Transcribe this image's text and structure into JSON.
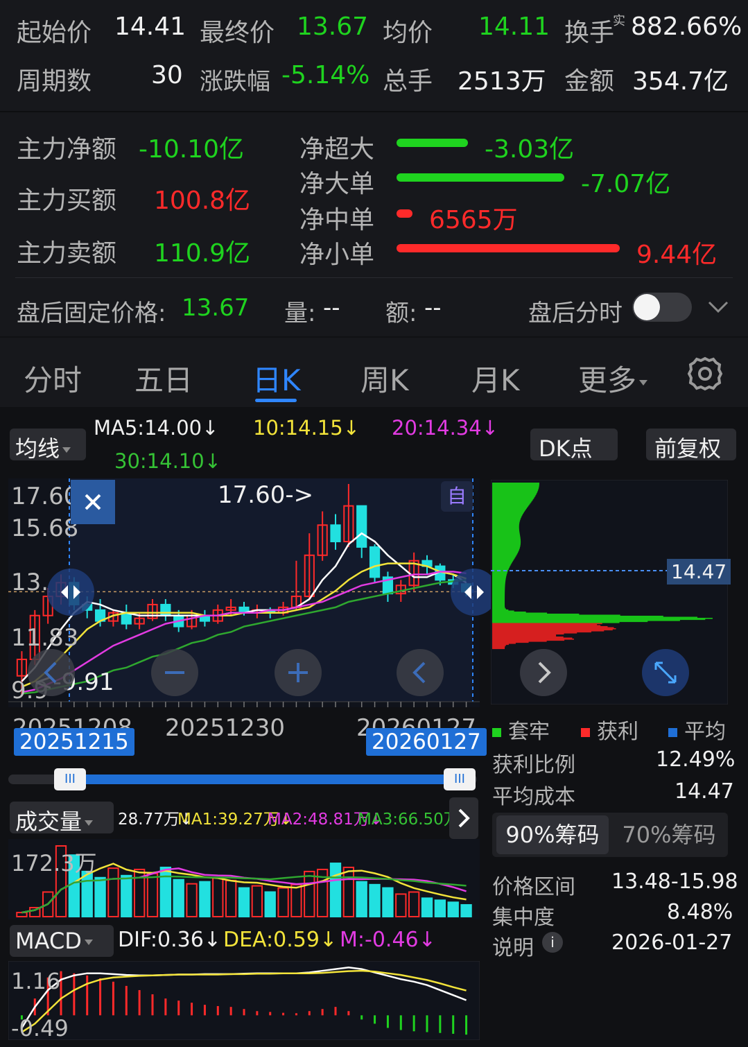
{
  "quote": {
    "open_label": "起始价",
    "open_value": "14.41",
    "close_label": "最终价",
    "close_value": "13.67",
    "avg_label": "均价",
    "avg_value": "14.11",
    "turnover_label": "换手",
    "turnover_sup": "实",
    "turnover_value": "882.66%",
    "periods_label": "周期数",
    "periods_value": "30",
    "change_label": "涨跌幅",
    "change_value": "-5.14%",
    "volume_label": "总手",
    "volume_value": "2513万",
    "amount_label": "金额",
    "amount_value": "354.7亿"
  },
  "flow": {
    "main_net_label": "主力净额",
    "main_net_value": "-10.10亿",
    "main_buy_label": "主力买额",
    "main_buy_value": "100.8亿",
    "main_sell_label": "主力卖额",
    "main_sell_value": "110.9亿",
    "rows": [
      {
        "label": "净超大",
        "value": "-3.03亿",
        "color": "#1fd31f",
        "fraction": 0.32
      },
      {
        "label": "净大单",
        "value": "-7.07亿",
        "color": "#1fd31f",
        "fraction": 0.75
      },
      {
        "label": "净中单",
        "value": "6565万",
        "color": "#ff2a2a",
        "fraction": 0.07
      },
      {
        "label": "净小单",
        "value": "9.44亿",
        "color": "#ff2a2a",
        "fraction": 1.0
      }
    ]
  },
  "after_hours": {
    "fixed_price_label": "盘后固定价格:",
    "fixed_price_value": "13.67",
    "qty_label": "量:",
    "qty_value": "--",
    "amt_label": "额:",
    "amt_value": "--",
    "timeshare_label": "盘后分时",
    "toggle_on": false
  },
  "tabs": {
    "items": [
      "分时",
      "五日",
      "日K",
      "周K",
      "月K",
      "更多"
    ],
    "active": "日K",
    "settings_icon": "gear-icon"
  },
  "ma_bar": {
    "selector_label": "均线",
    "ma5": "MA5:14.00↓",
    "ma10": "10:14.15↓",
    "ma20": "20:14.34↓",
    "ma30": "30:14.10↓",
    "dk_label": "DK点",
    "adjust_label": "前复权"
  },
  "kline": {
    "y_labels": [
      "17.60",
      "15.68",
      "13.",
      "11.83",
      "9.9"
    ],
    "high_marker": "17.60->",
    "low_marker": "<-9.91",
    "auto_label": "自",
    "x_labels": [
      "20251208",
      "20251230",
      "20260127"
    ],
    "range_start": "20251215",
    "range_end": "20260127"
  },
  "chip": {
    "price_tag": "14.47",
    "legend": [
      {
        "label": "套牢",
        "color": "#1fd31f"
      },
      {
        "label": "获利",
        "color": "#ff2a2a"
      },
      {
        "label": "平均",
        "color": "#1f6fd6"
      }
    ],
    "profit_ratio_label": "获利比例",
    "profit_ratio_value": "12.49%",
    "avg_cost_label": "平均成本",
    "avg_cost_value": "14.47",
    "tab_90": "90%筹码",
    "tab_70": "70%筹码",
    "range_label": "价格区间",
    "range_value": "13.48-15.98",
    "concentration_label": "集中度",
    "concentration_value": "8.48%",
    "note_label": "说明",
    "note_value": "2026-01-27"
  },
  "volume": {
    "selector_label": "成交量",
    "current": "28.77万↓",
    "ma1": "MA1:39.27万↓",
    "ma2": "MA2:48.81万↓",
    "ma3": "MA3:66.50万↓",
    "y_label": "172.3万"
  },
  "macd": {
    "selector_label": "MACD",
    "dif": "DIF:0.36↓",
    "dea": "DEA:0.59↓",
    "m": "M:-0.46↓",
    "y_top": "1.16",
    "y_bottom": "-0.49"
  },
  "colors": {
    "up": "#ff2a2a",
    "down": "#1fd31f",
    "down_candle": "#22e0e0",
    "ma5": "#ffffff",
    "ma10": "#f2e33a",
    "ma20": "#e23be2",
    "ma30": "#2fa82f",
    "accent": "#1f6fd6"
  },
  "chart_data": [
    {
      "type": "candlestick",
      "title": "",
      "ylim": [
        9.91,
        17.6
      ],
      "x": [
        "20251208",
        "20251209",
        "20251210",
        "20251211",
        "20251212",
        "20251215",
        "20251216",
        "20251217",
        "20251218",
        "20251219",
        "20251222",
        "20251223",
        "20251224",
        "20251225",
        "20251226",
        "20251229",
        "20251230",
        "20251231",
        "20260105",
        "20260106",
        "20260107",
        "20260108",
        "20260109",
        "20260112",
        "20260113",
        "20260114",
        "20260115",
        "20260116",
        "20260119",
        "20260120",
        "20260121",
        "20260122",
        "20260123",
        "20260126",
        "20260127"
      ],
      "series": [
        {
          "open": [
            10.6,
            11.2,
            12.8,
            13.5,
            14.0,
            13.2,
            13.0,
            12.6,
            12.9,
            12.5,
            12.7,
            13.2,
            12.8,
            12.4,
            12.8,
            12.6,
            13.0,
            13.1,
            12.9,
            13.0,
            12.9,
            13.1,
            13.5,
            15.0,
            16.1,
            15.5,
            16.8,
            15.3,
            14.2,
            13.6,
            13.9,
            14.8,
            14.6,
            14.1,
            13.95
          ],
          "close": [
            11.2,
            12.8,
            13.5,
            14.0,
            13.2,
            13.0,
            12.6,
            12.9,
            12.5,
            12.7,
            13.2,
            12.8,
            12.4,
            12.8,
            12.6,
            13.0,
            13.1,
            12.9,
            13.0,
            12.9,
            13.1,
            13.5,
            15.0,
            16.1,
            15.5,
            16.8,
            15.3,
            14.2,
            13.6,
            13.9,
            14.8,
            14.6,
            14.1,
            13.95,
            13.67
          ],
          "high": [
            11.5,
            13.0,
            13.8,
            14.3,
            14.2,
            13.5,
            13.4,
            13.0,
            13.2,
            12.9,
            13.4,
            13.4,
            13.0,
            13.0,
            13.0,
            13.2,
            13.4,
            13.3,
            13.2,
            13.1,
            13.3,
            14.8,
            15.8,
            16.6,
            16.5,
            17.6,
            16.7,
            15.4,
            14.4,
            14.1,
            15.1,
            15.0,
            14.7,
            14.3,
            14.0
          ],
          "low": [
            9.91,
            11.0,
            12.5,
            13.2,
            13.0,
            12.7,
            12.4,
            12.4,
            12.3,
            12.3,
            12.6,
            12.6,
            12.2,
            12.3,
            12.4,
            12.5,
            12.8,
            12.8,
            12.7,
            12.7,
            12.8,
            13.0,
            13.4,
            14.8,
            15.2,
            15.3,
            14.9,
            14.0,
            13.3,
            13.3,
            13.7,
            14.3,
            13.9,
            13.8,
            13.5
          ]
        }
      ],
      "ma": {
        "MA5": [
          10.4,
          10.9,
          11.6,
          12.3,
          12.9,
          13.3,
          13.2,
          13.0,
          12.9,
          12.8,
          12.8,
          12.8,
          12.8,
          12.8,
          12.8,
          12.8,
          12.9,
          12.9,
          13.0,
          13.0,
          13.0,
          13.1,
          13.4,
          14.1,
          14.6,
          15.4,
          15.8,
          15.5,
          15.0,
          14.6,
          14.2,
          14.2,
          14.4,
          14.3,
          14.0
        ],
        "MA10": [
          10.2,
          10.4,
          10.8,
          11.3,
          11.8,
          12.3,
          12.6,
          12.8,
          12.9,
          12.9,
          12.9,
          12.9,
          12.9,
          12.9,
          12.8,
          12.8,
          12.8,
          12.9,
          12.9,
          12.9,
          12.9,
          13.0,
          13.1,
          13.4,
          13.7,
          14.1,
          14.4,
          14.6,
          14.7,
          14.7,
          14.7,
          14.6,
          14.4,
          14.3,
          14.15
        ],
        "MA20": [
          10.0,
          10.1,
          10.3,
          10.5,
          10.8,
          11.1,
          11.4,
          11.7,
          11.9,
          12.1,
          12.3,
          12.5,
          12.6,
          12.7,
          12.8,
          12.8,
          12.9,
          12.9,
          12.9,
          13.0,
          13.0,
          13.1,
          13.2,
          13.3,
          13.5,
          13.7,
          13.9,
          14.0,
          14.1,
          14.2,
          14.3,
          14.3,
          14.4,
          14.4,
          14.34
        ],
        "MA30": [
          9.95,
          10.0,
          10.1,
          10.2,
          10.3,
          10.4,
          10.6,
          10.8,
          10.9,
          11.1,
          11.3,
          11.4,
          11.6,
          11.8,
          11.9,
          12.1,
          12.2,
          12.4,
          12.5,
          12.6,
          12.7,
          12.8,
          12.9,
          13.0,
          13.1,
          13.3,
          13.4,
          13.5,
          13.6,
          13.7,
          13.8,
          13.9,
          14.0,
          14.05,
          14.1
        ]
      }
    },
    {
      "type": "bar",
      "title": "成交量",
      "ylim": [
        0,
        172.3
      ],
      "values": [
        10,
        22,
        60,
        172.3,
        150,
        110,
        95,
        118,
        100,
        115,
        105,
        120,
        90,
        80,
        85,
        95,
        88,
        70,
        75,
        60,
        70,
        78,
        110,
        115,
        130,
        120,
        85,
        78,
        70,
        55,
        60,
        45,
        40,
        35,
        28.77
      ]
    },
    {
      "type": "bar",
      "title": "MACD",
      "ylim": [
        -0.49,
        1.16
      ],
      "values": [
        -0.1,
        0.4,
        0.9,
        1.05,
        1.0,
        0.95,
        0.88,
        0.8,
        0.7,
        0.6,
        0.5,
        0.4,
        0.35,
        0.3,
        0.25,
        0.22,
        0.2,
        0.15,
        0.1,
        0.08,
        0.06,
        0.05,
        0.1,
        0.15,
        0.2,
        0.1,
        -0.1,
        -0.2,
        -0.3,
        -0.35,
        -0.38,
        -0.4,
        -0.42,
        -0.44,
        -0.46
      ]
    }
  ]
}
